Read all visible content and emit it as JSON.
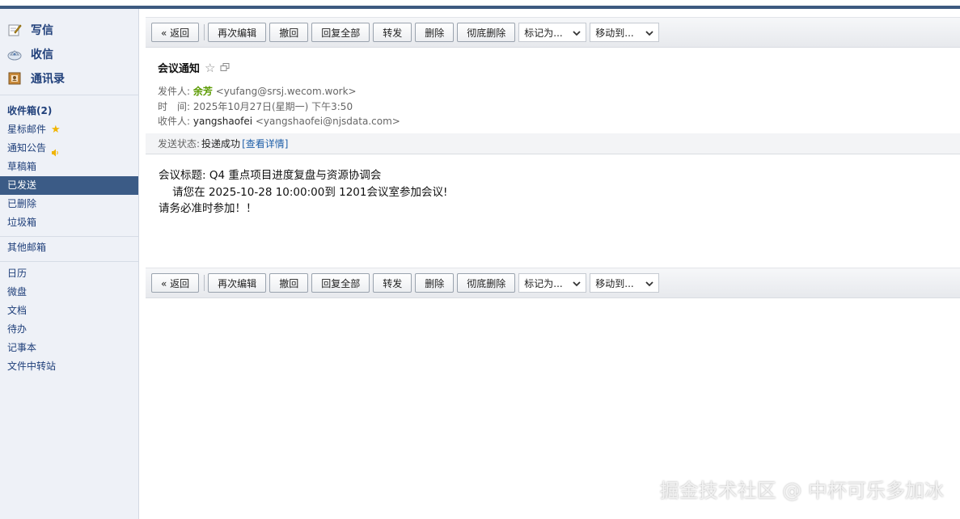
{
  "sidebar": {
    "quick": [
      {
        "label": "写信",
        "icon": "pencil-note-icon"
      },
      {
        "label": "收信",
        "icon": "inbox-tray-icon"
      },
      {
        "label": "通讯录",
        "icon": "address-book-icon"
      }
    ],
    "folders": [
      {
        "label": "收件箱(2)"
      },
      {
        "label": "星标邮件"
      },
      {
        "label": "通知公告"
      },
      {
        "label": "草稿箱"
      },
      {
        "label": "已发送"
      },
      {
        "label": "已删除"
      },
      {
        "label": "垃圾箱"
      }
    ],
    "other": "其他邮箱",
    "apps": [
      {
        "label": "日历"
      },
      {
        "label": "微盘"
      },
      {
        "label": "文档"
      },
      {
        "label": "待办"
      },
      {
        "label": "记事本"
      },
      {
        "label": "文件中转站"
      }
    ]
  },
  "toolbar": {
    "back": "« 返回",
    "reedit": "再次编辑",
    "recall": "撤回",
    "reply_all": "回复全部",
    "forward": "转发",
    "delete": "删除",
    "delete_perm": "彻底删除",
    "mark_as": "标记为...",
    "move_to": "移动到..."
  },
  "mail": {
    "subject": "会议通知",
    "from_label": "发件人:",
    "from_name": "余芳",
    "from_addr": "<yufang@srsj.wecom.work>",
    "time_label": "时　间:",
    "time_value": "2025年10月27日(星期一) 下午3:50",
    "to_label": "收件人:",
    "to_name": "yangshaofei",
    "to_addr": "<yangshaofei@njsdata.com>",
    "status_label": "发送状态:",
    "status_value": "投递成功",
    "status_detail": "[查看详情]",
    "body": [
      "会议标题:  Q4 重点项目进度复盘与资源协调会",
      "    请您在 2025-10-28 10:00:00到 1201会议室参加会议!",
      "请务必准时参加！！"
    ]
  },
  "watermark": "掘金技术社区 @ 中杯可乐多加冰",
  "colors": {
    "sidebar_bg": "#eef1f7",
    "active_bg": "#3b5b86",
    "link": "#1f3f7a",
    "sender": "#5a9a00"
  }
}
